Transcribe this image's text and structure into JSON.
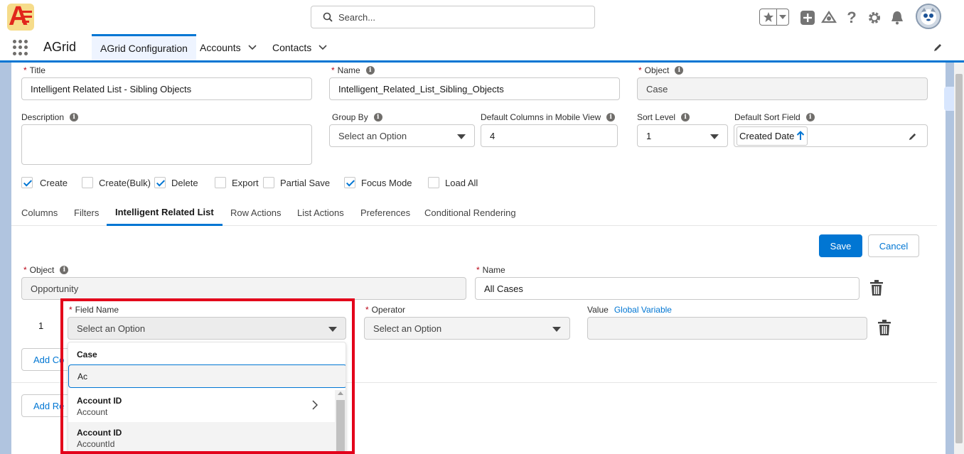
{
  "header": {
    "search_placeholder": "Search..."
  },
  "nav": {
    "app_name": "AGrid",
    "tabs": [
      {
        "label": "AGrid Configuration",
        "active": true
      },
      {
        "label": "Accounts"
      },
      {
        "label": "Contacts"
      }
    ]
  },
  "form": {
    "title": {
      "label": "Title",
      "value": "Intelligent Related List - Sibling Objects"
    },
    "name": {
      "label": "Name",
      "value": "Intelligent_Related_List_Sibling_Objects"
    },
    "object": {
      "label": "Object",
      "value": "Case"
    },
    "description": {
      "label": "Description",
      "value": ""
    },
    "group_by": {
      "label": "Group By",
      "value": "Select an Option"
    },
    "default_columns_mobile": {
      "label": "Default Columns in Mobile View",
      "value": "4"
    },
    "sort_level": {
      "label": "Sort Level",
      "value": "1"
    },
    "default_sort_field": {
      "label": "Default Sort Field",
      "value": "Created Date"
    },
    "checkboxes": [
      {
        "label": "Create",
        "checked": true
      },
      {
        "label": "Create(Bulk)",
        "checked": false
      },
      {
        "label": "Delete",
        "checked": true
      },
      {
        "label": "Export",
        "checked": false
      },
      {
        "label": "Partial Save",
        "checked": false
      },
      {
        "label": "Focus Mode",
        "checked": true
      },
      {
        "label": "Load All",
        "checked": false
      }
    ]
  },
  "tabs": [
    {
      "label": "Columns"
    },
    {
      "label": "Filters"
    },
    {
      "label": "Intelligent Related List",
      "active": true
    },
    {
      "label": "Row Actions"
    },
    {
      "label": "List Actions"
    },
    {
      "label": "Preferences"
    },
    {
      "label": "Conditional Rendering"
    }
  ],
  "irl": {
    "save_label": "Save",
    "cancel_label": "Cancel",
    "object": {
      "label": "Object",
      "value": "Opportunity"
    },
    "name": {
      "label": "Name",
      "value": "All Cases"
    },
    "condition": {
      "row_number": "1",
      "field_name": {
        "label": "Field Name",
        "value": "Select an Option"
      },
      "operator": {
        "label": "Operator",
        "value": "Select an Option"
      },
      "value": {
        "label": "Value",
        "link": "Global Variable",
        "value": ""
      }
    },
    "add_condition_label": "Add Co",
    "add_related_label": "Add Re"
  },
  "dropdown": {
    "group_header": "Case",
    "search_value": "Ac",
    "items": [
      {
        "title": "Account ID",
        "subtitle": "Account",
        "has_children": true
      },
      {
        "title": "Account ID",
        "subtitle": "AccountId",
        "has_children": false
      }
    ]
  },
  "colors": {
    "brand": "#0176d3",
    "highlight_border": "#e3001b",
    "required": "#ba0517"
  }
}
